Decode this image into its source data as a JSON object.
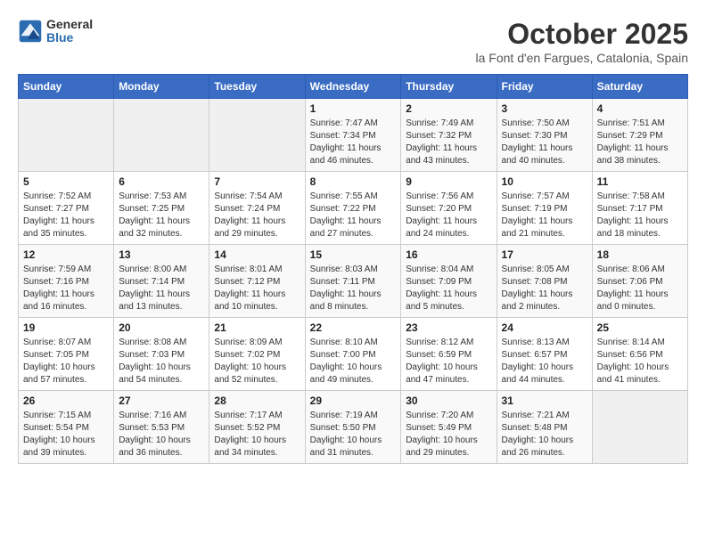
{
  "header": {
    "logo_line1": "General",
    "logo_line2": "Blue",
    "month": "October 2025",
    "location": "la Font d'en Fargues, Catalonia, Spain"
  },
  "weekdays": [
    "Sunday",
    "Monday",
    "Tuesday",
    "Wednesday",
    "Thursday",
    "Friday",
    "Saturday"
  ],
  "weeks": [
    [
      {
        "day": "",
        "info": ""
      },
      {
        "day": "",
        "info": ""
      },
      {
        "day": "",
        "info": ""
      },
      {
        "day": "1",
        "info": "Sunrise: 7:47 AM\nSunset: 7:34 PM\nDaylight: 11 hours and 46 minutes."
      },
      {
        "day": "2",
        "info": "Sunrise: 7:49 AM\nSunset: 7:32 PM\nDaylight: 11 hours and 43 minutes."
      },
      {
        "day": "3",
        "info": "Sunrise: 7:50 AM\nSunset: 7:30 PM\nDaylight: 11 hours and 40 minutes."
      },
      {
        "day": "4",
        "info": "Sunrise: 7:51 AM\nSunset: 7:29 PM\nDaylight: 11 hours and 38 minutes."
      }
    ],
    [
      {
        "day": "5",
        "info": "Sunrise: 7:52 AM\nSunset: 7:27 PM\nDaylight: 11 hours and 35 minutes."
      },
      {
        "day": "6",
        "info": "Sunrise: 7:53 AM\nSunset: 7:25 PM\nDaylight: 11 hours and 32 minutes."
      },
      {
        "day": "7",
        "info": "Sunrise: 7:54 AM\nSunset: 7:24 PM\nDaylight: 11 hours and 29 minutes."
      },
      {
        "day": "8",
        "info": "Sunrise: 7:55 AM\nSunset: 7:22 PM\nDaylight: 11 hours and 27 minutes."
      },
      {
        "day": "9",
        "info": "Sunrise: 7:56 AM\nSunset: 7:20 PM\nDaylight: 11 hours and 24 minutes."
      },
      {
        "day": "10",
        "info": "Sunrise: 7:57 AM\nSunset: 7:19 PM\nDaylight: 11 hours and 21 minutes."
      },
      {
        "day": "11",
        "info": "Sunrise: 7:58 AM\nSunset: 7:17 PM\nDaylight: 11 hours and 18 minutes."
      }
    ],
    [
      {
        "day": "12",
        "info": "Sunrise: 7:59 AM\nSunset: 7:16 PM\nDaylight: 11 hours and 16 minutes."
      },
      {
        "day": "13",
        "info": "Sunrise: 8:00 AM\nSunset: 7:14 PM\nDaylight: 11 hours and 13 minutes."
      },
      {
        "day": "14",
        "info": "Sunrise: 8:01 AM\nSunset: 7:12 PM\nDaylight: 11 hours and 10 minutes."
      },
      {
        "day": "15",
        "info": "Sunrise: 8:03 AM\nSunset: 7:11 PM\nDaylight: 11 hours and 8 minutes."
      },
      {
        "day": "16",
        "info": "Sunrise: 8:04 AM\nSunset: 7:09 PM\nDaylight: 11 hours and 5 minutes."
      },
      {
        "day": "17",
        "info": "Sunrise: 8:05 AM\nSunset: 7:08 PM\nDaylight: 11 hours and 2 minutes."
      },
      {
        "day": "18",
        "info": "Sunrise: 8:06 AM\nSunset: 7:06 PM\nDaylight: 11 hours and 0 minutes."
      }
    ],
    [
      {
        "day": "19",
        "info": "Sunrise: 8:07 AM\nSunset: 7:05 PM\nDaylight: 10 hours and 57 minutes."
      },
      {
        "day": "20",
        "info": "Sunrise: 8:08 AM\nSunset: 7:03 PM\nDaylight: 10 hours and 54 minutes."
      },
      {
        "day": "21",
        "info": "Sunrise: 8:09 AM\nSunset: 7:02 PM\nDaylight: 10 hours and 52 minutes."
      },
      {
        "day": "22",
        "info": "Sunrise: 8:10 AM\nSunset: 7:00 PM\nDaylight: 10 hours and 49 minutes."
      },
      {
        "day": "23",
        "info": "Sunrise: 8:12 AM\nSunset: 6:59 PM\nDaylight: 10 hours and 47 minutes."
      },
      {
        "day": "24",
        "info": "Sunrise: 8:13 AM\nSunset: 6:57 PM\nDaylight: 10 hours and 44 minutes."
      },
      {
        "day": "25",
        "info": "Sunrise: 8:14 AM\nSunset: 6:56 PM\nDaylight: 10 hours and 41 minutes."
      }
    ],
    [
      {
        "day": "26",
        "info": "Sunrise: 7:15 AM\nSunset: 5:54 PM\nDaylight: 10 hours and 39 minutes."
      },
      {
        "day": "27",
        "info": "Sunrise: 7:16 AM\nSunset: 5:53 PM\nDaylight: 10 hours and 36 minutes."
      },
      {
        "day": "28",
        "info": "Sunrise: 7:17 AM\nSunset: 5:52 PM\nDaylight: 10 hours and 34 minutes."
      },
      {
        "day": "29",
        "info": "Sunrise: 7:19 AM\nSunset: 5:50 PM\nDaylight: 10 hours and 31 minutes."
      },
      {
        "day": "30",
        "info": "Sunrise: 7:20 AM\nSunset: 5:49 PM\nDaylight: 10 hours and 29 minutes."
      },
      {
        "day": "31",
        "info": "Sunrise: 7:21 AM\nSunset: 5:48 PM\nDaylight: 10 hours and 26 minutes."
      },
      {
        "day": "",
        "info": ""
      }
    ]
  ]
}
